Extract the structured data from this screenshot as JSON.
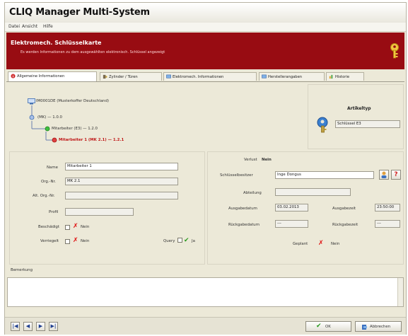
{
  "window": {
    "title": "CLIQ Manager Multi-System"
  },
  "menu": [
    "Datei",
    "Ansicht",
    "Hilfe"
  ],
  "banner": {
    "heading": "Elektromech. Schlüsselkarte",
    "subtitle": "Es werden Informationen zu dem ausgewählten elektronisch. Schlüssel angezeigt"
  },
  "tabs": [
    {
      "label": "Allgemeine Informationen",
      "icon": "info-icon"
    },
    {
      "label": "Zylinder / Türen",
      "icon": "cylinder-icon"
    },
    {
      "label": "Elektromech. Informationen",
      "icon": "monitor-icon"
    },
    {
      "label": "Herstellerangaben",
      "icon": "monitor-icon"
    },
    {
      "label": "Historie",
      "icon": "history-icon"
    }
  ],
  "tree": {
    "root": "IM0001DE (Musterkoffer Deutschland)",
    "level1": "(MK) — 1.0.0",
    "level2": "Mitarbeiter (E3) — 1.2.0",
    "level3": "Mitarbeiter 1 (MK 2.1) — 1.2.1"
  },
  "article_type": {
    "label": "Artikeltyp",
    "value": "Schlüssel E3"
  },
  "form_left": {
    "name_label": "Name",
    "name_value": "Mitarbeiter 1",
    "org_label": "Org.-Nr.",
    "org_value": "MK 2.1",
    "alt_org_label": "Alt. Org.-Nr.",
    "alt_org_value": "",
    "profil_label": "Profil",
    "profil_value": "",
    "damaged_label": "Beschädigt",
    "damaged_value": "Nein",
    "locked_label": "Verriegelt",
    "locked_value": "Nein",
    "query_label": "Query",
    "query_value": "Ja"
  },
  "form_right": {
    "lost_label": "Verlust",
    "lost_value": "Nein",
    "holder_label": "Schlüsselbesitzer",
    "holder_value": "Inge Dongus",
    "dept_label": "Abteilung",
    "dept_value": "",
    "issue_date_label": "Ausgabedatum",
    "issue_date_value": "03.02.2013",
    "issue_time_label": "Ausgabezeit",
    "issue_time_value": "23:50:00",
    "return_date_label": "Rückgabedatum",
    "return_date_value": "---",
    "return_time_label": "Rückgabezeit",
    "return_time_value": "---",
    "planned_label": "Geplant",
    "planned_value": "Nein"
  },
  "remark": {
    "label": "Bemerkung",
    "value": ""
  },
  "footer": {
    "ok_label": "OK",
    "cancel_label": "Abbrechen"
  },
  "colors": {
    "banner": "#980c12",
    "accent_blue": "#1f3f90",
    "red_x": "#e01010",
    "green_check": "#2a9a20"
  }
}
